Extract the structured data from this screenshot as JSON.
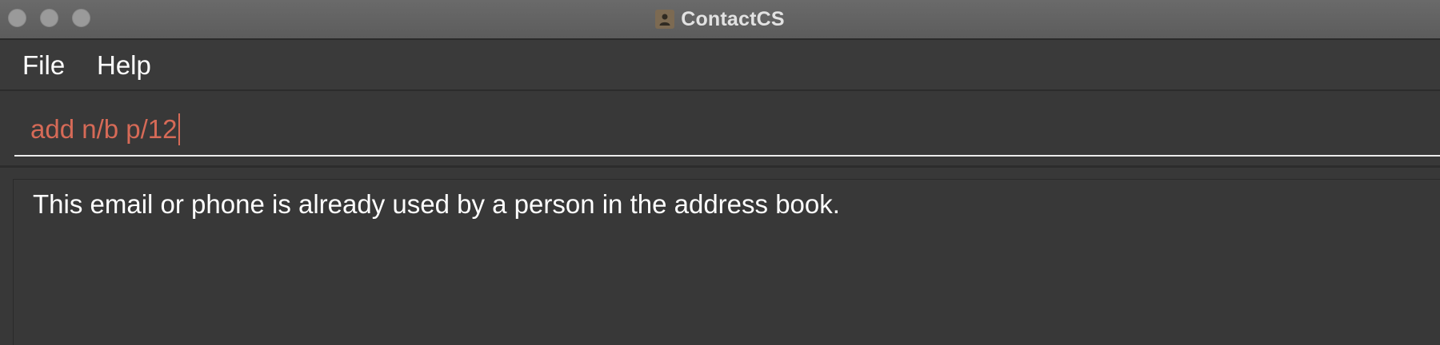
{
  "window": {
    "title": "ContactCS",
    "app_icon": "contact-book-icon"
  },
  "menubar": {
    "items": [
      {
        "label": "File"
      },
      {
        "label": "Help"
      }
    ]
  },
  "command_box": {
    "value": "add n/b p/12"
  },
  "result_display": {
    "message": "This email or phone is already used by a person in the address book."
  },
  "colors": {
    "command_text": "#d66a57",
    "background": "#383838",
    "titlebar": "#5f5f5f"
  }
}
